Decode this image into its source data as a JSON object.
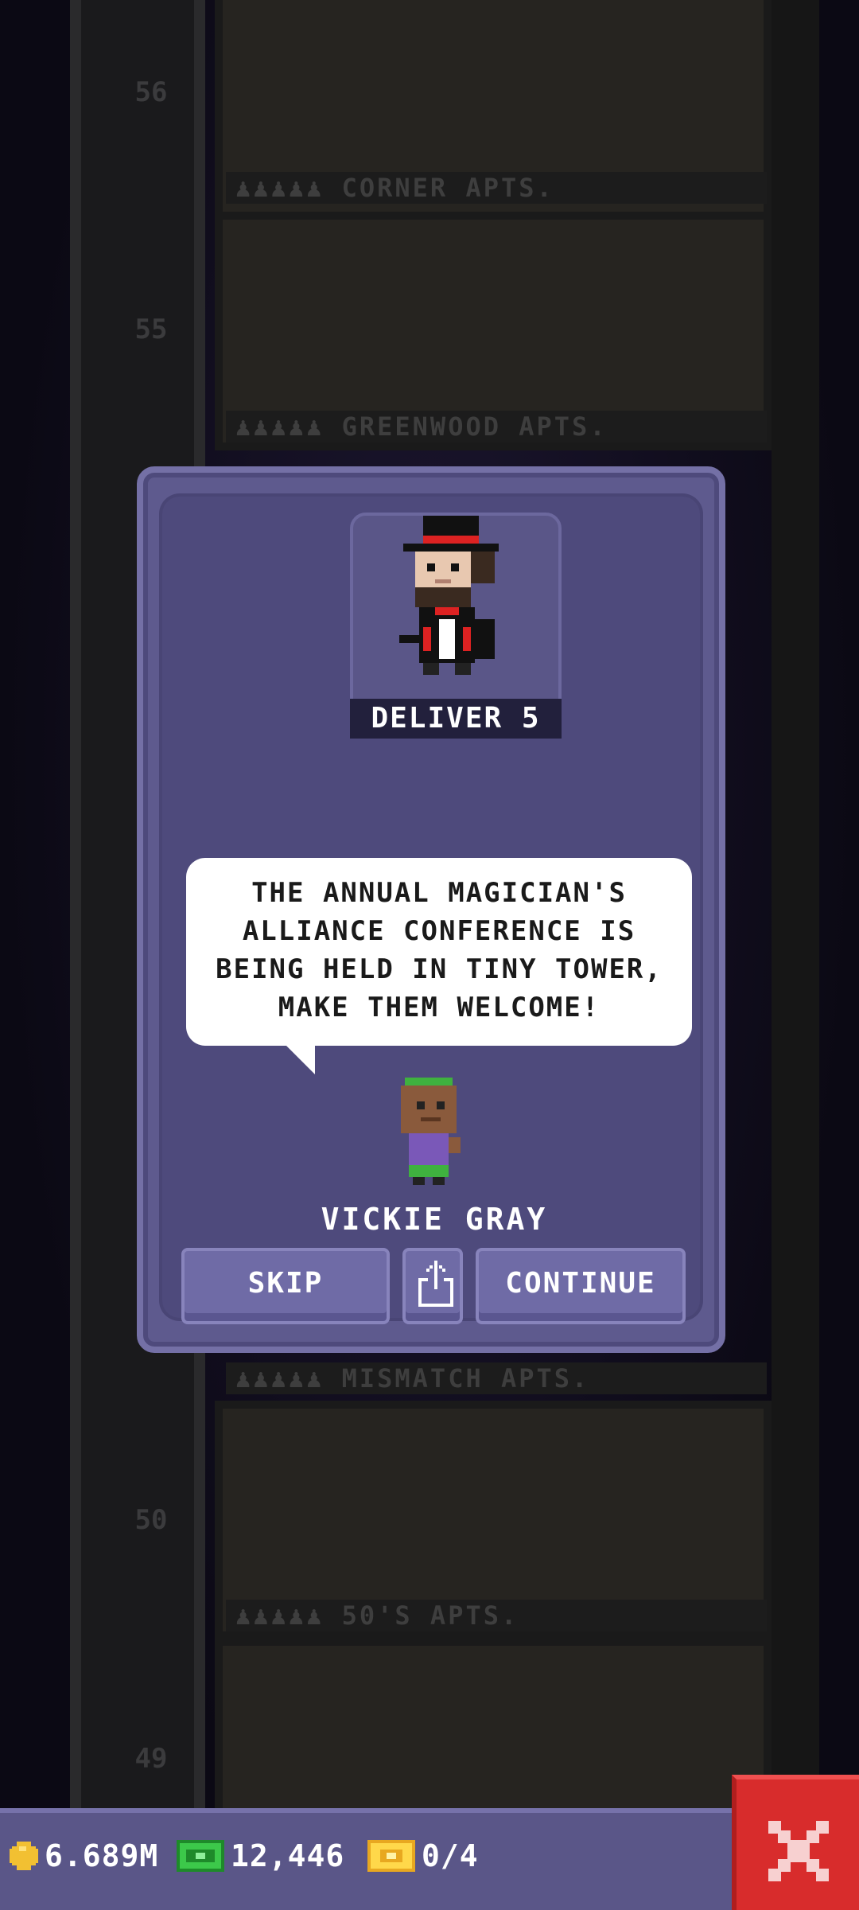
{
  "background": {
    "floors": [
      {
        "number": "56",
        "label": "♟♟♟♟♟ CORNER APTS."
      },
      {
        "number": "55",
        "label": "♟♟♟♟♟ GREENWOOD APTS."
      },
      {
        "number": "50",
        "label": "♟♟♟♟♟ MISMATCH APTS."
      },
      {
        "number": "49",
        "label": "♟♟♟♟♟ 50'S APTS."
      }
    ]
  },
  "mission": {
    "task_label": "DELIVER 5",
    "message": "THE ANNUAL MAGICIAN'S ALLIANCE CONFERENCE IS BEING HELD IN TINY TOWER, MAKE THEM WELCOME!",
    "speaker_name": "VICKIE GRAY",
    "skip_label": "SKIP",
    "continue_label": "CONTINUE",
    "share_icon": "share-icon"
  },
  "status_bar": {
    "coins": "6.689M",
    "bux": "12,446",
    "tickets": "0/4"
  },
  "colors": {
    "modal": "#5e5a8e",
    "close": "#d82c2c",
    "bar": "#5a5688"
  }
}
